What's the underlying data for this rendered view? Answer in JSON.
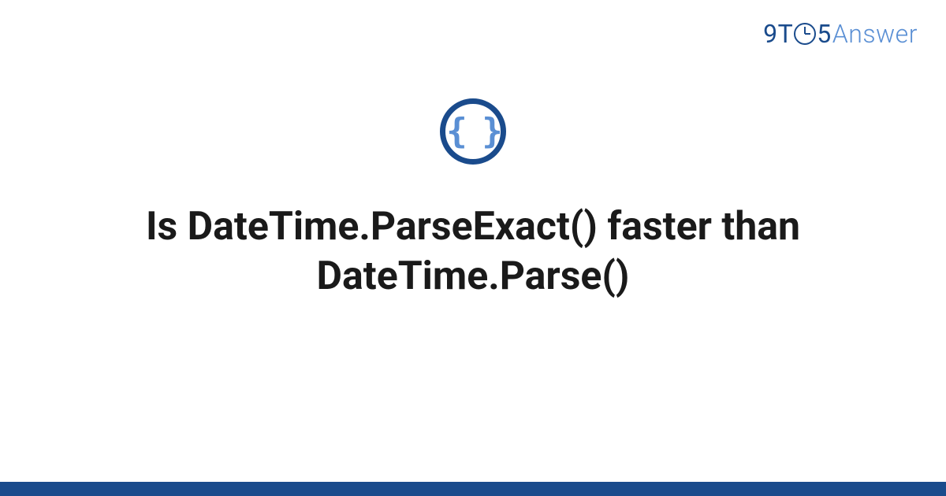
{
  "brand": {
    "prefix": "9T",
    "middle": "5",
    "suffix": "Answer"
  },
  "icon": {
    "glyph": "{ }",
    "name": "code-braces-icon"
  },
  "title": "Is DateTime.ParseExact() faster than DateTime.Parse()",
  "colors": {
    "primary": "#1a4b8c",
    "accent": "#5a8fd4"
  }
}
